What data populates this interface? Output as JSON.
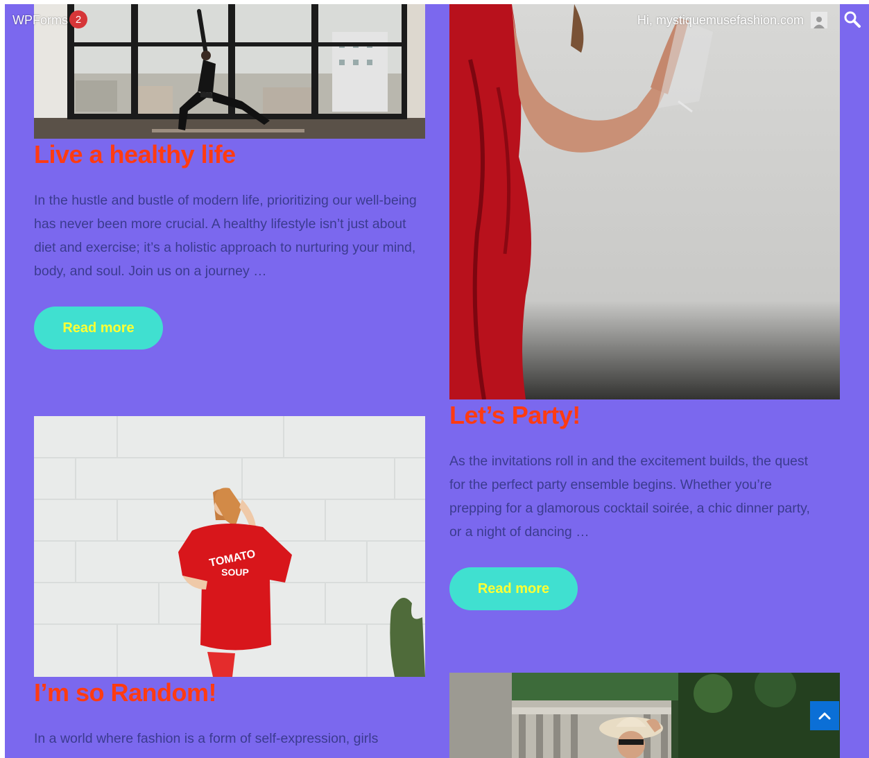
{
  "adminbar": {
    "forms_label": "WPForms",
    "notification_count": "2",
    "greeting": "Hi, mystiquemusefashion.com"
  },
  "posts": [
    {
      "title": "Live a healthy life",
      "excerpt": "In the hustle and bustle of modern life, prioritizing our well-being has never been more crucial. A healthy lifestyle isn’t just about diet and exercise; it’s a holistic approach to nurturing your mind, body, and soul. Join us on a journey …",
      "read_more": "Read more"
    },
    {
      "title": "Let’s Party!",
      "excerpt": "As the invitations roll in and the excitement builds, the quest for the perfect party ensemble begins. Whether you’re prepping for a glamorous cocktail soirée, a chic dinner party, or a night of dancing …",
      "read_more": "Read more"
    },
    {
      "title": "I’m so Random!",
      "excerpt": "In a world where fashion is a form of self-expression, girls"
    }
  ],
  "sweater_text": {
    "line1": "TOMATO",
    "line2": "SOUP"
  },
  "colors": {
    "background": "#7b68ee",
    "title": "#ff3b12",
    "excerpt": "#3b3b8f",
    "button": "#40e0d0",
    "button_text": "#ffff33",
    "scroll_top": "#0b6fd6"
  },
  "icons": {
    "search": "search-icon",
    "avatar": "user-avatar-icon",
    "scroll_top": "chevron-up-icon"
  }
}
